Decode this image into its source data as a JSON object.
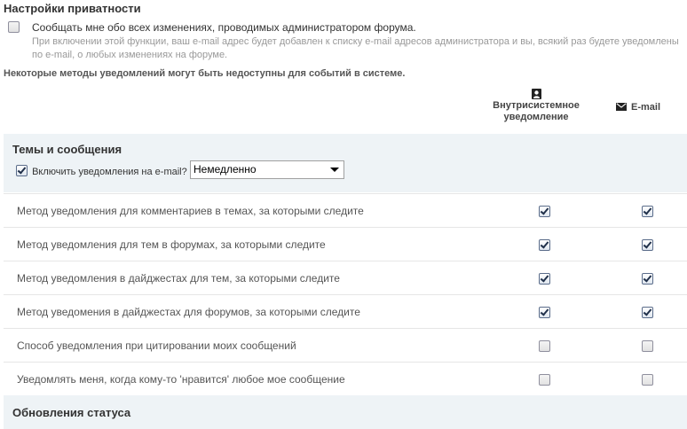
{
  "privacy": {
    "title": "Настройки приватности",
    "option_label": "Сообщать мне обо всех изменениях, проводимых администратором форума.",
    "option_description": "При включении этой функции, ваш e-mail адрес будет добавлен к списку e-mail адресов администратора и вы, всякий раз будете уведомлены по e-mail, о любых изменениях на форуме.",
    "option_checked": false
  },
  "note": "Некоторые методы уведомлений могут быть недоступны для событий в системе.",
  "columns": {
    "inapp": {
      "label": "Внутрисистемное уведомление",
      "icon": "user-icon"
    },
    "email": {
      "label": "E-mail",
      "icon": "envelope-icon"
    }
  },
  "sections": {
    "themes": {
      "title": "Темы и сообщения",
      "enable_email_label": "Включить уведомления на e-mail?",
      "enable_email_checked": true,
      "frequency_value": "Немедленно"
    },
    "status": {
      "title": "Обновления статуса"
    }
  },
  "rows": [
    {
      "label": "Метод уведомления для комментариев в темах, за которыми следите",
      "inapp": true,
      "email": true
    },
    {
      "label": "Метод уведомления для тем в форумах, за которыми следите",
      "inapp": true,
      "email": true
    },
    {
      "label": "Метод уведомления в дайджестах для тем, за которыми следите",
      "inapp": true,
      "email": true
    },
    {
      "label": "Метод уведомения в дайджестах для форумов, за которыми следите",
      "inapp": true,
      "email": true
    },
    {
      "label": "Способ уведомления при цитировании моих сообщений",
      "inapp": false,
      "email": false
    },
    {
      "label": "Уведомлять меня, когда кому-то 'нравится' любое мое сообщение",
      "inapp": false,
      "email": false
    }
  ]
}
